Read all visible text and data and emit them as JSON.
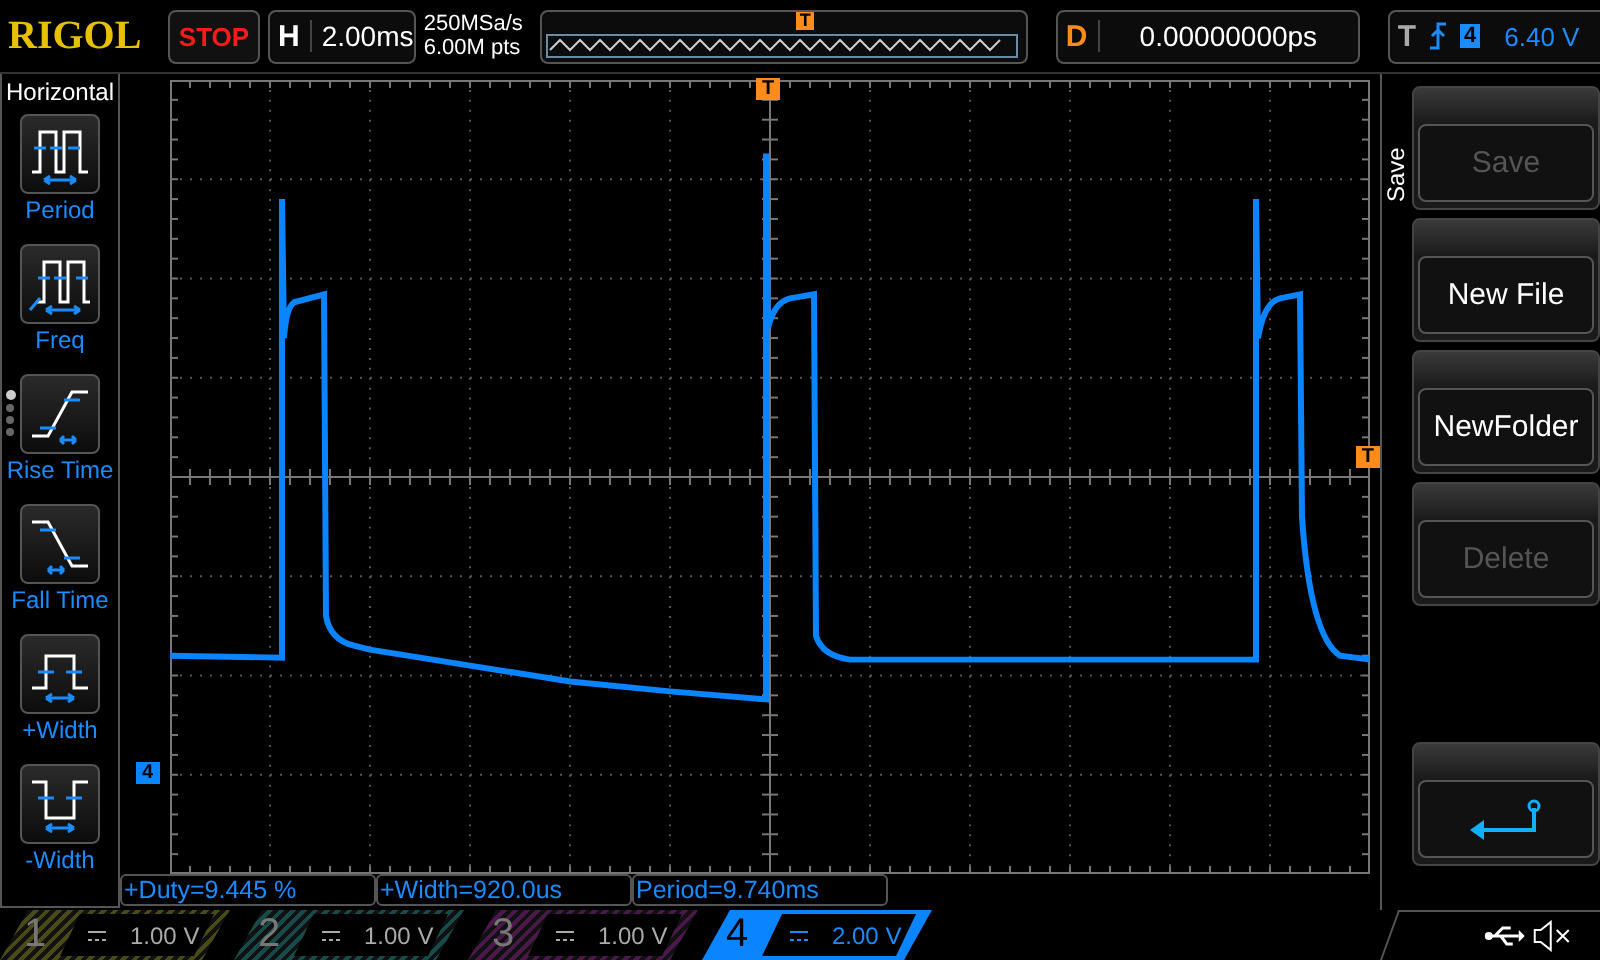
{
  "brand": "RIGOL",
  "run_state": {
    "label": "STOP",
    "kind": "stop"
  },
  "horizontal": {
    "label": "H",
    "value": "2.00ms"
  },
  "acquisition": {
    "sample_rate": "250MSa/s",
    "memory_depth": "6.00M pts"
  },
  "memory_bar": {
    "trigger_marker": "T"
  },
  "delay": {
    "label": "D",
    "value": "0.00000000ps"
  },
  "trigger": {
    "label": "T",
    "rising_edge": true,
    "source": "4",
    "level": "6.40 V"
  },
  "left_panel": {
    "title": "Horizontal",
    "items": [
      {
        "kind": "period",
        "label": "Period"
      },
      {
        "kind": "freq",
        "label": "Freq"
      },
      {
        "kind": "rise",
        "label": "Rise Time"
      },
      {
        "kind": "fall",
        "label": "Fall Time"
      },
      {
        "kind": "pwidth",
        "label": "+Width"
      },
      {
        "kind": "nwidth",
        "label": "-Width"
      }
    ],
    "pages": [
      {
        "selected": true
      },
      {
        "selected": false
      },
      {
        "selected": false
      },
      {
        "selected": false
      }
    ]
  },
  "screen": {
    "trigger_position_marker": "T",
    "trigger_level_marker": "T",
    "channel_marker": "4"
  },
  "measurements": [
    "+Duty=9.445 %",
    "+Width=920.0us",
    "Period=9.740ms"
  ],
  "right_menu": {
    "title": "Save",
    "buttons": [
      {
        "kind": "text",
        "label": "Save",
        "disabled": true
      },
      {
        "kind": "text",
        "label": "New File",
        "disabled": false
      },
      {
        "kind": "text",
        "label": "NewFolder",
        "disabled": false
      },
      {
        "kind": "text",
        "label": "Delete",
        "disabled": true
      },
      {
        "kind": "back",
        "disabled": false
      }
    ]
  },
  "channels": [
    {
      "number": "1",
      "scale": "1.00 V",
      "active": false,
      "color": "#4a4a18"
    },
    {
      "number": "2",
      "scale": "1.00 V",
      "active": false,
      "color": "#184a4a"
    },
    {
      "number": "3",
      "scale": "1.00 V",
      "active": false,
      "color": "#4a184a"
    },
    {
      "number": "4",
      "scale": "2.00 V",
      "active": true,
      "color": "#0a84ff"
    }
  ],
  "status": {
    "usb": true,
    "muted": true
  }
}
